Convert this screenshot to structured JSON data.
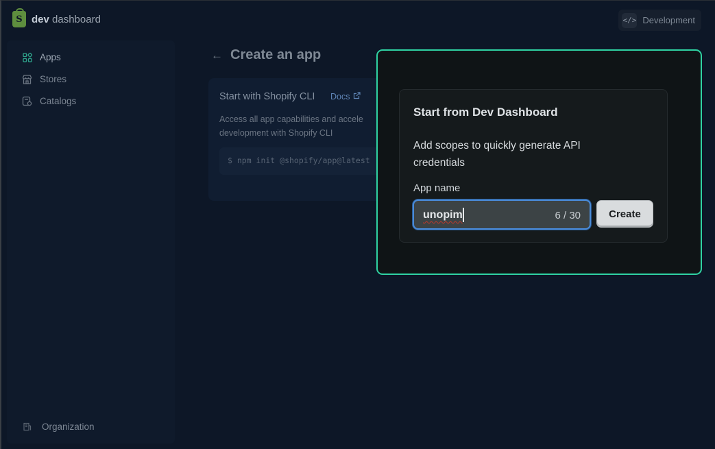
{
  "header": {
    "logo_bold": "dev",
    "logo_rest": "dashboard",
    "env_label": "Development",
    "env_icon": "code-icon"
  },
  "sidebar": {
    "items": [
      {
        "label": "Apps",
        "icon": "apps-grid-icon",
        "active": true
      },
      {
        "label": "Stores",
        "icon": "store-icon",
        "active": false
      },
      {
        "label": "Catalogs",
        "icon": "catalog-icon",
        "active": false
      }
    ],
    "footer": {
      "label": "Organization",
      "icon": "building-icon"
    }
  },
  "page": {
    "title": "Create an app"
  },
  "cli_card": {
    "title": "Start with Shopify CLI",
    "docs_label": "Docs",
    "description_line1": "Access all app capabilities and accele",
    "description_line2": "development with Shopify CLI",
    "command": "$ npm init @shopify/app@latest"
  },
  "modal": {
    "title": "Start from Dev Dashboard",
    "description": "Add scopes to quickly generate API credentials",
    "field_label": "App name",
    "input_value": "unopim",
    "char_count": "6 / 30",
    "create_label": "Create"
  },
  "colors": {
    "accent_border": "#2fd3a3",
    "focus_ring": "#4a8bd8",
    "shopify_green": "#5e8e3e"
  }
}
